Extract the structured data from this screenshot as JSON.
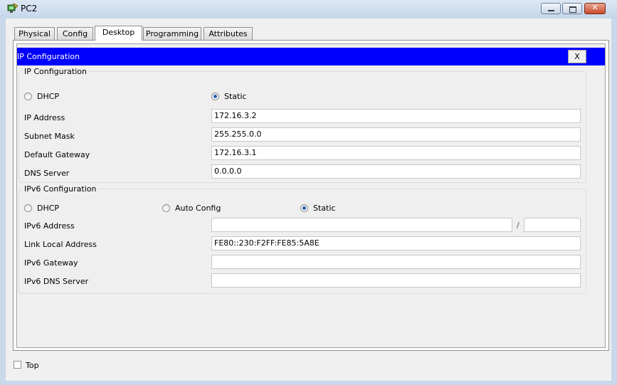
{
  "window": {
    "title": "PC2",
    "icon": "pc-icon",
    "controls": [
      "minimize-icon",
      "maximize-icon",
      "close-icon"
    ]
  },
  "tabs": [
    {
      "label": "Physical",
      "active": false
    },
    {
      "label": "Config",
      "active": false
    },
    {
      "label": "Desktop",
      "active": true
    },
    {
      "label": "Programming",
      "active": false
    },
    {
      "label": "Attributes",
      "active": false
    }
  ],
  "app": {
    "title": "IP Configuration",
    "close_label": "X",
    "header_color": "#0000ff"
  },
  "ipv4": {
    "group_title": "IP Configuration",
    "dhcp_label": "DHCP",
    "static_label": "Static",
    "selected_mode": "Static",
    "ip_label": "IP Address",
    "ip_value": "172.16.3.2",
    "subnet_label": "Subnet Mask",
    "subnet_value": "255.255.0.0",
    "gateway_label": "Default Gateway",
    "gateway_value": "172.16.3.1",
    "dns_label": "DNS Server",
    "dns_value": "0.0.0.0"
  },
  "ipv6": {
    "group_title": "IPv6 Configuration",
    "dhcp_label": "DHCP",
    "auto_label": "Auto Config",
    "static_label": "Static",
    "selected_mode": "Static",
    "address_label": "IPv6 Address",
    "address_value": "",
    "prefix_separator": "/",
    "prefix_value": "",
    "link_local_label": "Link Local Address",
    "link_local_value": "FE80::230:F2FF:FE85:5A8E",
    "gateway_label": "IPv6 Gateway",
    "gateway_value": "",
    "dns_label": "IPv6 DNS Server",
    "dns_value": ""
  },
  "footer": {
    "top_label": "Top",
    "top_checked": false
  }
}
